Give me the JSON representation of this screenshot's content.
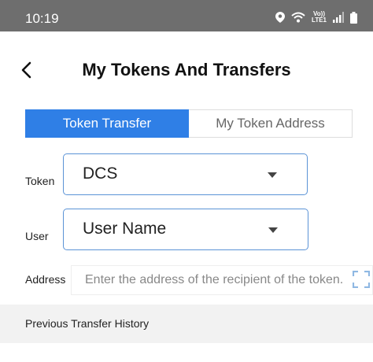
{
  "status_bar": {
    "time": "10:19",
    "volte_top": "Vo))",
    "volte_bottom": "LTE1"
  },
  "header": {
    "title": "My Tokens And Transfers",
    "back_icon": "chevron-left-icon"
  },
  "tabs": [
    {
      "label": "Token Transfer",
      "active": true
    },
    {
      "label": "My Token Address",
      "active": false
    }
  ],
  "form": {
    "token_label": "Token",
    "token_value": "DCS",
    "user_label": "User",
    "user_value": "User Name",
    "address_label": "Address",
    "address_placeholder": "Enter the address of the recipient of the token.",
    "address_value": ""
  },
  "history": {
    "label": "Previous Transfer History"
  },
  "colors": {
    "accent": "#2f7fe6",
    "select_border": "#5b93d6",
    "status_bar": "#6e6e6e",
    "history_bg": "#f2f2f2"
  }
}
